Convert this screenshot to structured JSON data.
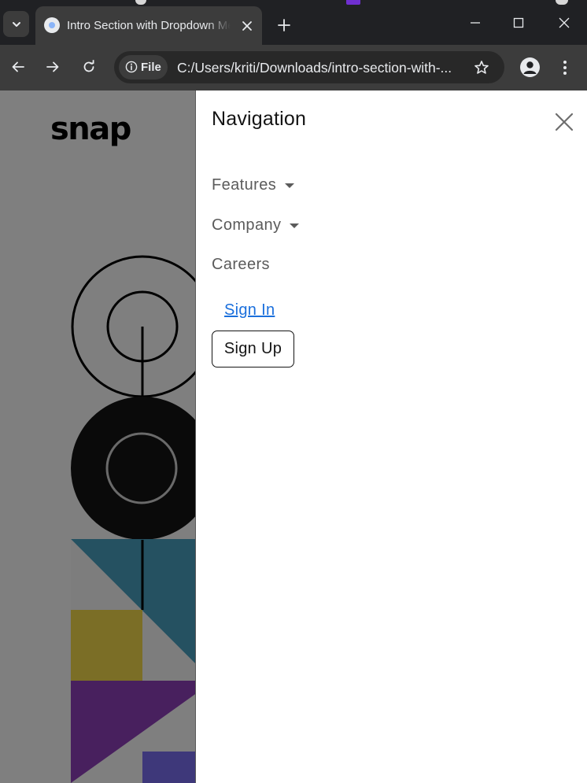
{
  "browser": {
    "tab": {
      "title": "Intro Section with Dropdown Menu"
    },
    "address_bar": {
      "chip_label": "File",
      "url": "C:/Users/kriti/Downloads/intro-section-with-..."
    },
    "icons": {
      "tab_search": "chevron-down-icon",
      "favicon": "globe-icon",
      "tab_close": "close-icon",
      "new_tab": "plus-icon",
      "minimize": "minimize-icon",
      "maximize": "maximize-icon",
      "close": "close-icon",
      "back": "arrow-left-icon",
      "forward": "arrow-right-icon",
      "reload": "reload-icon",
      "info": "info-icon",
      "bookmark": "star-icon",
      "profile": "person-icon",
      "menu": "kebab-menu-icon"
    }
  },
  "page": {
    "logo": "snap",
    "drawer": {
      "title": "Navigation",
      "items": [
        {
          "label": "Features",
          "has_dropdown": true
        },
        {
          "label": "Company",
          "has_dropdown": true
        },
        {
          "label": "Careers",
          "has_dropdown": false
        }
      ],
      "sign_in": "Sign In",
      "sign_up": "Sign Up"
    },
    "colors": {
      "overlay": "rgba(0,0,0,0.49)",
      "link": "#1a6fdc",
      "teal": "#4a9fbe",
      "ochre": "#f2d74b",
      "purple": "#8e3fb8",
      "indigo": "#7a6ff0"
    }
  }
}
